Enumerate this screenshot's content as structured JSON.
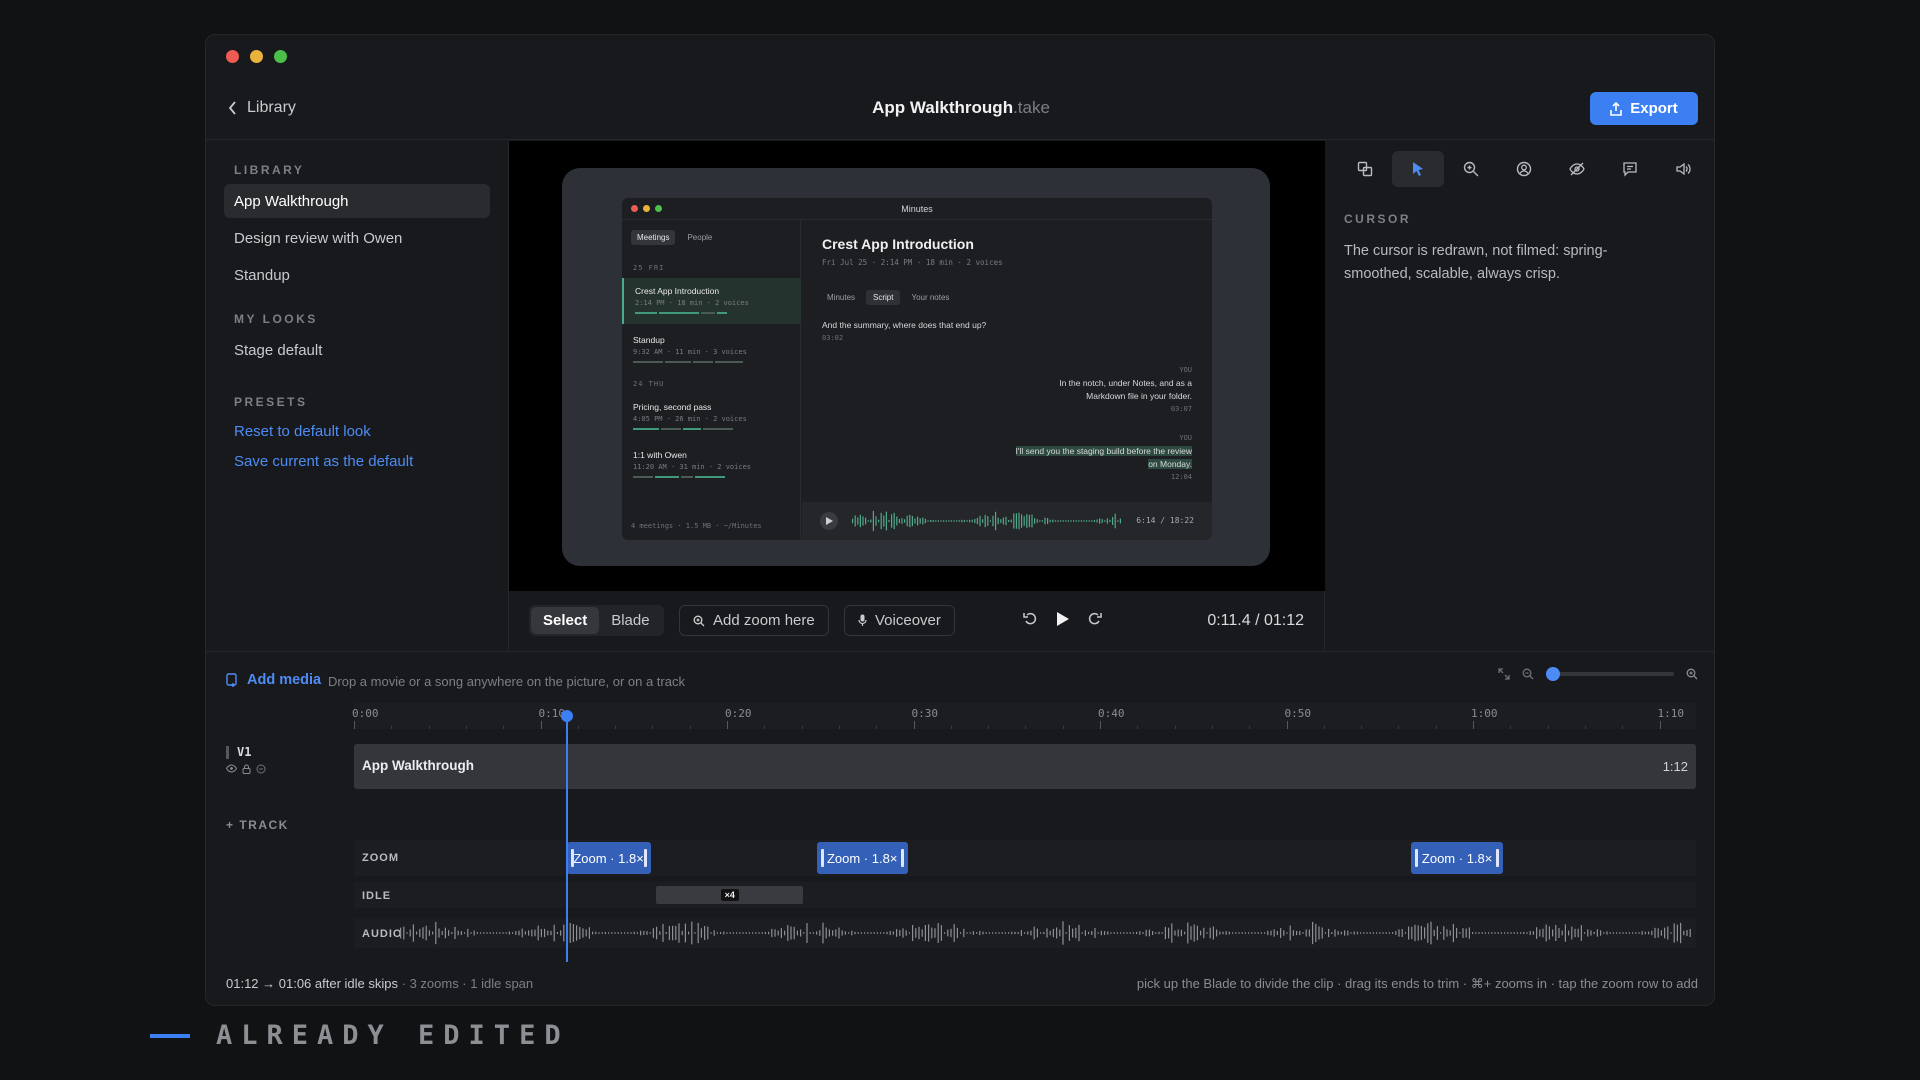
{
  "window": {
    "title": "App Walkthrough",
    "title_ext": ".take",
    "back_label": "Library",
    "export_label": "Export",
    "traffic_colors": [
      "#ed5b52",
      "#e9b23a",
      "#4bbf4a"
    ]
  },
  "sidebar": {
    "sections": [
      {
        "heading": "LIBRARY",
        "items": [
          "App Walkthrough",
          "Design review with Owen",
          "Standup"
        ]
      },
      {
        "heading": "MY LOOKS",
        "items": [
          "Stage default"
        ]
      },
      {
        "heading": "PRESETS",
        "links": [
          "Reset to default look",
          "Save current as the default"
        ]
      }
    ]
  },
  "preview": {
    "app_title": "Minutes",
    "tabs": [
      "Meetings",
      "People"
    ],
    "days": [
      "25 FRI",
      "24 THU"
    ],
    "meetings": [
      {
        "title": "Crest App Introduction",
        "meta": "2:14 PM · 18 min · 2 voices"
      },
      {
        "title": "Standup",
        "meta": "9:32 AM · 11 min · 3 voices"
      },
      {
        "title": "Pricing, second pass",
        "meta": "4:05 PM · 26 min · 2 voices"
      },
      {
        "title": "1:1 with Owen",
        "meta": "11:20 AM · 31 min · 2 voices"
      }
    ],
    "list_footer": "4 meetings · 1.5 MB · ~/Minutes",
    "detail_title": "Crest App Introduction",
    "detail_meta": "Fri Jul 25 · 2:14 PM · 18 min · 2 voices",
    "detail_tabs": [
      "Minutes",
      "Script",
      "Your notes"
    ],
    "messages": [
      {
        "text": "And the summary, where does that end up?",
        "time": "03:02"
      },
      {
        "who": "YOU",
        "text": "In the notch, under Notes, and as a Markdown file in your folder.",
        "time": "03:07"
      },
      {
        "who": "YOU",
        "text": "I'll send you the staging build before the review on Monday.",
        "time": "12:04"
      }
    ],
    "player_time": "6:14 / 18:22"
  },
  "controls": {
    "mode_options": [
      "Select",
      "Blade"
    ],
    "add_zoom_label": "Add zoom here",
    "voiceover_label": "Voiceover",
    "timecode": "0:11.4 / 01:12"
  },
  "inspector": {
    "tools": [
      "layout-icon",
      "cursor-icon",
      "zoom-icon",
      "camera-icon",
      "hide-icon",
      "caption-icon",
      "audio-icon"
    ],
    "active_tool": "cursor-icon",
    "heading": "CURSOR",
    "description": "The cursor is redrawn, not filmed: spring-smoothed, scalable, always crisp."
  },
  "timeline": {
    "add_media_label": "Add media",
    "hint": "Drop a movie or a song anywhere on the picture, or on a track",
    "zoom_level": 0.05,
    "ruler_ticks": [
      "0:00",
      "0:10",
      "0:20",
      "0:30",
      "0:40",
      "0:50",
      "1:00",
      "1:10"
    ],
    "track_name": "V1",
    "clip_name": "App Walkthrough",
    "clip_duration": "1:12",
    "add_track_label": "TRACK",
    "lanes": {
      "zoom": "ZOOM",
      "idle": "IDLE",
      "audio": "AUDIO"
    },
    "zoom_blocks": [
      {
        "label": "Zoom · 1.8×",
        "start": 11.4,
        "end": 15.9
      },
      {
        "label": "Zoom · 1.8×",
        "start": 24.8,
        "end": 29.7
      },
      {
        "label": "Zoom · 1.8×",
        "start": 56.7,
        "end": 61.6
      }
    ],
    "idle_block": {
      "label": "×4",
      "start": 16.2,
      "end": 24.1
    },
    "playhead": 11.4,
    "duration_s": 72,
    "footer_summary": "01:12 → 01:06 after idle skips",
    "footer_counts": "· 3 zooms · 1 idle span",
    "footer_tip": "pick up the Blade to divide the clip · drag its ends to trim · ⌘+ zooms in · tap the zoom row to add"
  },
  "caption": {
    "text": "ALREADY EDITED",
    "accent": "#3b7ff3"
  }
}
